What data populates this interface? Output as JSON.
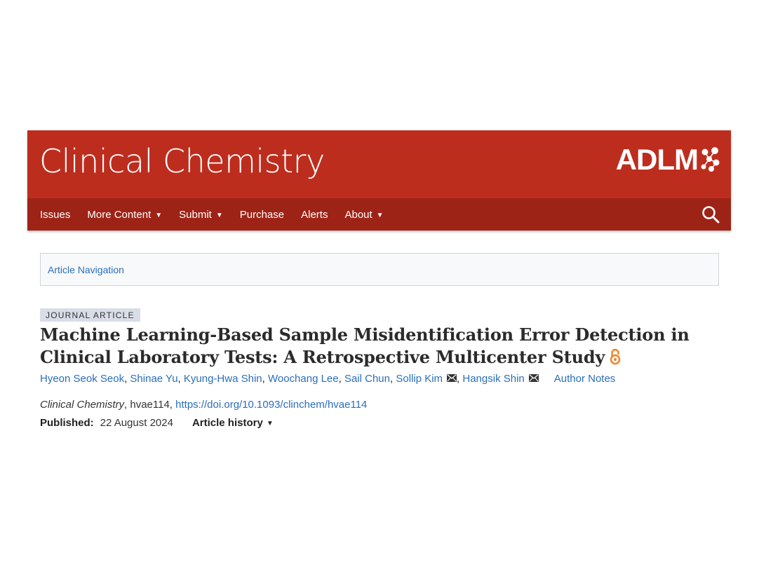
{
  "header": {
    "journal_title": "Clinical Chemistry",
    "society_logo": "ADLM",
    "brand_color": "#bd2d1e",
    "nav_color": "#9e2317"
  },
  "nav": {
    "items": [
      {
        "label": "Issues",
        "has_dropdown": false
      },
      {
        "label": "More Content",
        "has_dropdown": true
      },
      {
        "label": "Submit",
        "has_dropdown": true
      },
      {
        "label": "Purchase",
        "has_dropdown": false
      },
      {
        "label": "Alerts",
        "has_dropdown": false
      },
      {
        "label": "About",
        "has_dropdown": true
      }
    ],
    "search_icon": "search-icon"
  },
  "article_nav": {
    "label": "Article Navigation"
  },
  "article": {
    "type_badge": "JOURNAL ARTICLE",
    "title": "Machine Learning-Based Sample Misidentification Error Detection in Clinical Laboratory Tests: A Retrospective Multicenter Study",
    "open_access_icon": "open-access-icon",
    "authors": [
      {
        "name": "Hyeon Seok Seok",
        "email": false
      },
      {
        "name": "Shinae Yu",
        "email": false
      },
      {
        "name": "Kyung-Hwa Shin",
        "email": false
      },
      {
        "name": "Woochang Lee",
        "email": false
      },
      {
        "name": "Sail Chun",
        "email": false
      },
      {
        "name": "Sollip Kim",
        "email": true
      },
      {
        "name": "Hangsik Shin",
        "email": true
      }
    ],
    "author_notes_label": "Author Notes",
    "citation_journal": "Clinical Chemistry",
    "citation_id": ", hvae114, ",
    "doi": "https://doi.org/10.1093/clinchem/hvae114",
    "published_label": "Published:",
    "published_date": "22 August 2024",
    "history_label": "Article history",
    "link_color": "#2a6ebb",
    "oa_color": "#f48120"
  }
}
